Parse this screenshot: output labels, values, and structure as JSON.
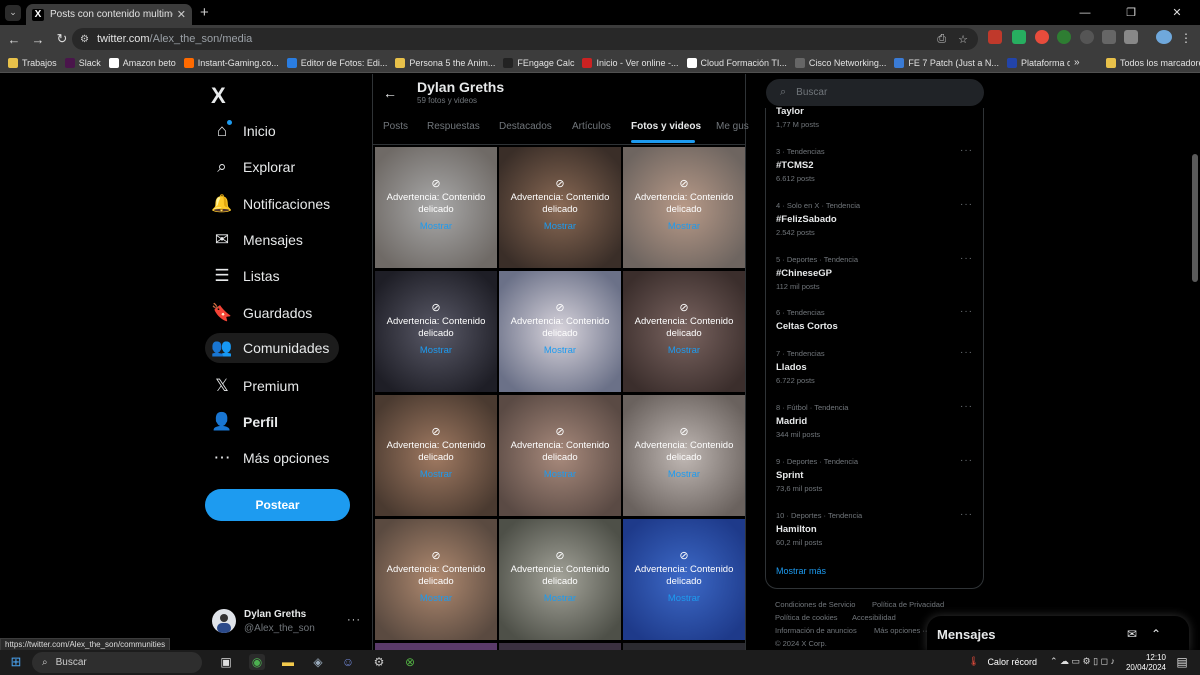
{
  "browser": {
    "tab_title": "Posts con contenido multimed",
    "tab_favicon": "X",
    "url_host": "twitter.com",
    "url_path": "/Alex_the_son/media",
    "bookmarks": [
      {
        "label": "Trabajos",
        "color": "#e8c14a"
      },
      {
        "label": "Slack",
        "color": "#4a154b"
      },
      {
        "label": "Amazon beto",
        "color": "#ffffff"
      },
      {
        "label": "Instant-Gaming.co...",
        "color": "#ff6a00"
      },
      {
        "label": "Editor de Fotos: Edi...",
        "color": "#2a7de1"
      },
      {
        "label": "Persona 5 the Anim...",
        "color": "#e8c14a"
      },
      {
        "label": "FEngage Calc",
        "color": "#222222"
      },
      {
        "label": "Inicio - Ver online -...",
        "color": "#cc2222"
      },
      {
        "label": "Cloud Formación TI...",
        "color": "#ffffff"
      },
      {
        "label": "Cisco Networking...",
        "color": "#666666"
      },
      {
        "label": "FE 7 Patch (Just a N...",
        "color": "#3a7bd5"
      },
      {
        "label": "Plataforma de For...",
        "color": "#2244aa"
      }
    ],
    "all_bookmarks": "Todos los marcadores",
    "more_bookmarks": "»"
  },
  "sidebar": {
    "logo": "X",
    "items": [
      {
        "label": "Inicio",
        "icon": "home-icon",
        "glyph": "⌂"
      },
      {
        "label": "Explorar",
        "icon": "search-icon",
        "glyph": "⌕"
      },
      {
        "label": "Notificaciones",
        "icon": "bell-icon",
        "glyph": "🔔"
      },
      {
        "label": "Mensajes",
        "icon": "envelope-icon",
        "glyph": "✉"
      },
      {
        "label": "Listas",
        "icon": "list-icon",
        "glyph": "☰"
      },
      {
        "label": "Guardados",
        "icon": "bookmark-icon",
        "glyph": "🔖"
      },
      {
        "label": "Comunidades",
        "icon": "people-icon",
        "glyph": "👥"
      },
      {
        "label": "Premium",
        "icon": "x-premium-icon",
        "glyph": "𝕏"
      },
      {
        "label": "Perfil",
        "icon": "person-icon",
        "glyph": "👤"
      },
      {
        "label": "Más opciones",
        "icon": "more-circle-icon",
        "glyph": "⋯"
      }
    ],
    "post_button": "Postear",
    "profile": {
      "name": "Dylan Greths",
      "handle": "@Alex_the_son"
    }
  },
  "profile_header": {
    "name": "Dylan Greths",
    "count": "59 fotos y videos"
  },
  "tabs": [
    "Posts",
    "Respuestas",
    "Destacados",
    "Artículos",
    "Fotos y videos",
    "Me gus"
  ],
  "active_tab": "Fotos y videos",
  "media": {
    "warning": "Advertencia: Contenido delicado",
    "show": "Mostrar",
    "tiles": [
      {
        "c1": "#a9a9a9",
        "c2": "#6f6a66"
      },
      {
        "c1": "#8a6a55",
        "c2": "#3a2e28"
      },
      {
        "c1": "#b89a88",
        "c2": "#6e6560"
      },
      {
        "c1": "#5a5a68",
        "c2": "#1e1e26"
      },
      {
        "c1": "#d8d4dc",
        "c2": "#6b7188"
      },
      {
        "c1": "#7a6460",
        "c2": "#3b2e2c"
      },
      {
        "c1": "#a07a62",
        "c2": "#4a3a30"
      },
      {
        "c1": "#a88a7c",
        "c2": "#5a4a44"
      },
      {
        "c1": "#c0b8b4",
        "c2": "#6a625e"
      },
      {
        "c1": "#b08a70",
        "c2": "#5a4a40"
      },
      {
        "c1": "#a4a49a",
        "c2": "#4e5048"
      },
      {
        "c1": "#3d6ac8",
        "c2": "#1e3a8a"
      }
    ]
  },
  "search": {
    "placeholder": "Buscar"
  },
  "trends": [
    {
      "meta": "",
      "name": "Taylor",
      "count": "1,77 M posts"
    },
    {
      "meta": "3 · Tendencias",
      "name": "#TCMS2",
      "count": "6.612 posts"
    },
    {
      "meta": "4 · Solo en X · Tendencia",
      "name": "#FelizSabado",
      "count": "2.542 posts"
    },
    {
      "meta": "5 · Deportes · Tendencia",
      "name": "#ChineseGP",
      "count": "112 mil posts"
    },
    {
      "meta": "6 · Tendencias",
      "name": "Celtas Cortos",
      "count": ""
    },
    {
      "meta": "7 · Tendencias",
      "name": "Llados",
      "count": "6.722 posts"
    },
    {
      "meta": "8 · Fútbol · Tendencia",
      "name": "Madrid",
      "count": "344 mil posts"
    },
    {
      "meta": "9 · Deportes · Tendencia",
      "name": "Sprint",
      "count": "73,6 mil posts"
    },
    {
      "meta": "10 · Deportes · Tendencia",
      "name": "Hamilton",
      "count": "60,2 mil posts"
    }
  ],
  "show_more": "Mostrar más",
  "footer": {
    "links": [
      "Condiciones de Servicio",
      "Política de Privacidad",
      "Política de cookies",
      "Accesibilidad",
      "Información de anuncios",
      "Más opciones ···"
    ],
    "copyright": "© 2024 X Corp."
  },
  "messages_drawer": {
    "title": "Mensajes"
  },
  "status_url": "https://twitter.com/Alex_the_son/communities",
  "taskbar": {
    "search": "Buscar",
    "weather": "Calor récord",
    "time": "12:10",
    "date": "20/04/2024"
  }
}
